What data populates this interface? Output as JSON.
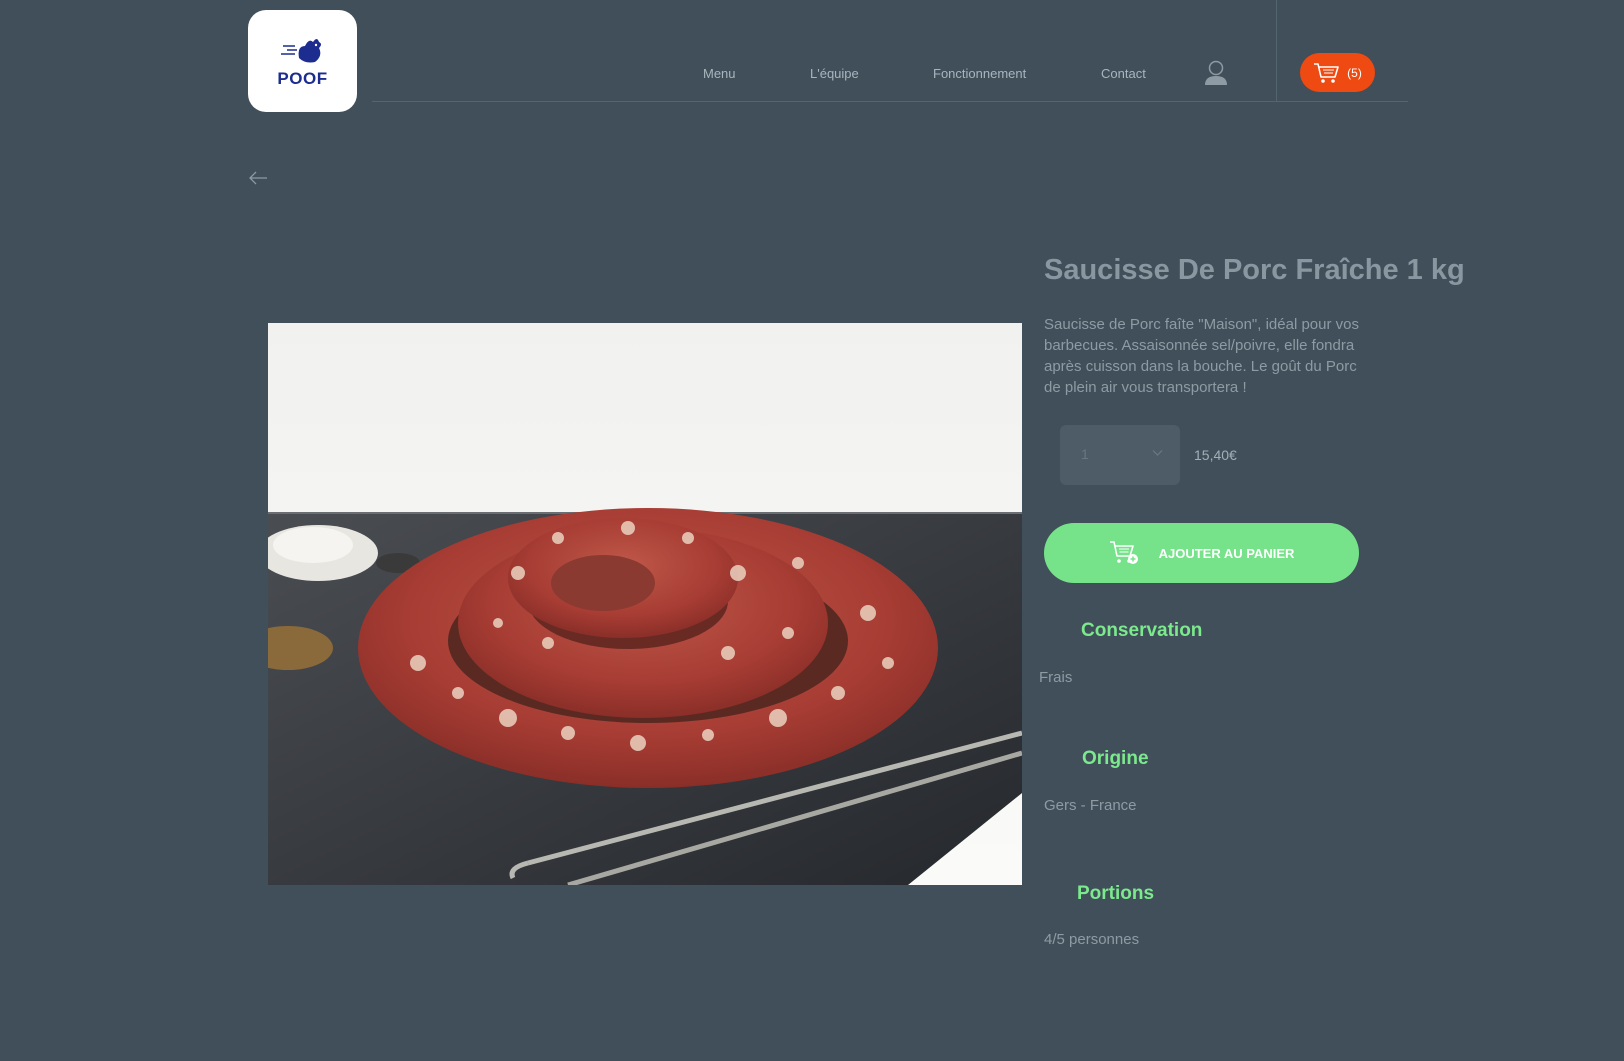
{
  "header": {
    "logo_text": "POOF",
    "nav": [
      "Menu",
      "L'équipe",
      "Fonctionnement",
      "Contact"
    ],
    "cart_count": "(5)",
    "icons": {
      "user": "user-icon",
      "cart": "cart-icon",
      "back": "arrow-left-icon"
    }
  },
  "product": {
    "title": "Saucisse De Porc Fraîche 1 kg",
    "description": "Saucisse de Porc faîte \"Maison\", idéal pour vos barbecues. Assaisonnée sel/poivre, elle fondra après cuisson dans la bouche. Le goût du Porc de plein air vous transportera !",
    "quantity": "1",
    "price": "15,40€",
    "add_to_cart_label": "AJOUTER AU PANIER"
  },
  "details": {
    "conservation_title": "Conservation",
    "conservation_value": "Frais",
    "origine_title": "Origine",
    "origine_value": "Gers - France",
    "portions_title": "Portions",
    "portions_value": "4/5 personnes"
  },
  "colors": {
    "background": "#404f5a",
    "accent_orange": "#ee4a12",
    "accent_green": "#76e38a",
    "section_green": "#7be98c",
    "logo_blue": "#1c2d8f"
  }
}
